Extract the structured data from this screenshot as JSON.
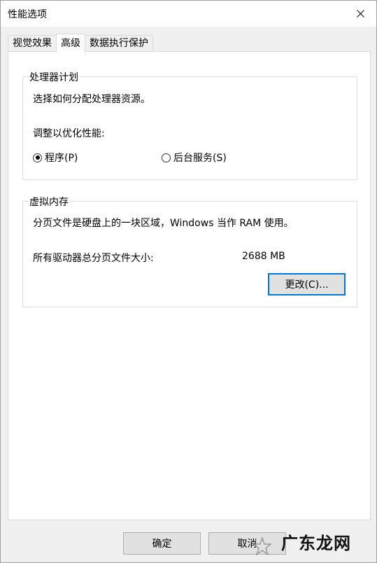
{
  "window": {
    "title": "性能选项"
  },
  "tabs": [
    {
      "label": "视觉效果",
      "active": false
    },
    {
      "label": "高级",
      "active": true
    },
    {
      "label": "数据执行保护",
      "active": false
    }
  ],
  "processor": {
    "group_label": "处理器计划",
    "description": "选择如何分配处理器资源。",
    "adjust_label": "调整以优化性能:",
    "option_programs": "程序(P)",
    "option_background": "后台服务(S)",
    "selected": "programs"
  },
  "virtual_memory": {
    "group_label": "虚拟内存",
    "description": "分页文件是硬盘上的一块区域，Windows 当作 RAM 使用。",
    "total_label": "所有驱动器总分页文件大小:",
    "total_value": "2688 MB",
    "change_button": "更改(C)..."
  },
  "footer": {
    "ok_button": "确定",
    "cancel_button": "取消"
  },
  "watermark": {
    "text": "广东龙网"
  }
}
